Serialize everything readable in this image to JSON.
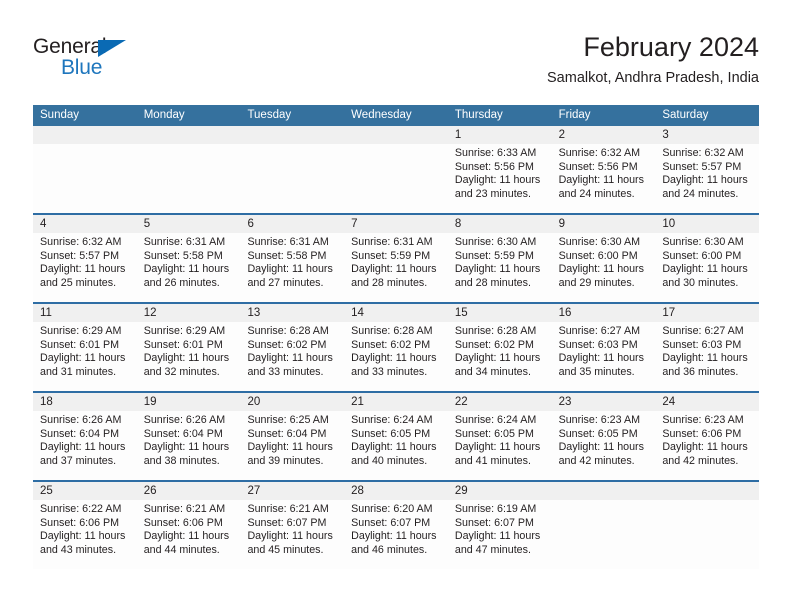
{
  "brand": {
    "name_part1": "General",
    "name_part2": "Blue",
    "triangle_color": "#0a6ab4",
    "blue_text_color": "#1e76bd"
  },
  "header": {
    "title": "February 2024",
    "subtitle": "Samalkot, Andhra Pradesh, India"
  },
  "theme": {
    "header_bg": "#35719e",
    "header_text": "#ffffff",
    "daynum_band_bg": "#f0f0f0",
    "week_separator": "#2e6da4",
    "body_bg": "#fdfdfd",
    "text_color": "#231f20"
  },
  "weekday_headers": [
    "Sunday",
    "Monday",
    "Tuesday",
    "Wednesday",
    "Thursday",
    "Friday",
    "Saturday"
  ],
  "labels": {
    "sunrise_prefix": "Sunrise:",
    "sunset_prefix": "Sunset:",
    "daylight_prefix": "Daylight:"
  },
  "weeks": [
    {
      "days": [
        {
          "num": "",
          "line1": "",
          "line2": "",
          "line3": "",
          "line4": ""
        },
        {
          "num": "",
          "line1": "",
          "line2": "",
          "line3": "",
          "line4": ""
        },
        {
          "num": "",
          "line1": "",
          "line2": "",
          "line3": "",
          "line4": ""
        },
        {
          "num": "",
          "line1": "",
          "line2": "",
          "line3": "",
          "line4": ""
        },
        {
          "num": "1",
          "line1": "Sunrise: 6:33 AM",
          "line2": "Sunset: 5:56 PM",
          "line3": "Daylight: 11 hours",
          "line4": "and 23 minutes."
        },
        {
          "num": "2",
          "line1": "Sunrise: 6:32 AM",
          "line2": "Sunset: 5:56 PM",
          "line3": "Daylight: 11 hours",
          "line4": "and 24 minutes."
        },
        {
          "num": "3",
          "line1": "Sunrise: 6:32 AM",
          "line2": "Sunset: 5:57 PM",
          "line3": "Daylight: 11 hours",
          "line4": "and 24 minutes."
        }
      ]
    },
    {
      "days": [
        {
          "num": "4",
          "line1": "Sunrise: 6:32 AM",
          "line2": "Sunset: 5:57 PM",
          "line3": "Daylight: 11 hours",
          "line4": "and 25 minutes."
        },
        {
          "num": "5",
          "line1": "Sunrise: 6:31 AM",
          "line2": "Sunset: 5:58 PM",
          "line3": "Daylight: 11 hours",
          "line4": "and 26 minutes."
        },
        {
          "num": "6",
          "line1": "Sunrise: 6:31 AM",
          "line2": "Sunset: 5:58 PM",
          "line3": "Daylight: 11 hours",
          "line4": "and 27 minutes."
        },
        {
          "num": "7",
          "line1": "Sunrise: 6:31 AM",
          "line2": "Sunset: 5:59 PM",
          "line3": "Daylight: 11 hours",
          "line4": "and 28 minutes."
        },
        {
          "num": "8",
          "line1": "Sunrise: 6:30 AM",
          "line2": "Sunset: 5:59 PM",
          "line3": "Daylight: 11 hours",
          "line4": "and 28 minutes."
        },
        {
          "num": "9",
          "line1": "Sunrise: 6:30 AM",
          "line2": "Sunset: 6:00 PM",
          "line3": "Daylight: 11 hours",
          "line4": "and 29 minutes."
        },
        {
          "num": "10",
          "line1": "Sunrise: 6:30 AM",
          "line2": "Sunset: 6:00 PM",
          "line3": "Daylight: 11 hours",
          "line4": "and 30 minutes."
        }
      ]
    },
    {
      "days": [
        {
          "num": "11",
          "line1": "Sunrise: 6:29 AM",
          "line2": "Sunset: 6:01 PM",
          "line3": "Daylight: 11 hours",
          "line4": "and 31 minutes."
        },
        {
          "num": "12",
          "line1": "Sunrise: 6:29 AM",
          "line2": "Sunset: 6:01 PM",
          "line3": "Daylight: 11 hours",
          "line4": "and 32 minutes."
        },
        {
          "num": "13",
          "line1": "Sunrise: 6:28 AM",
          "line2": "Sunset: 6:02 PM",
          "line3": "Daylight: 11 hours",
          "line4": "and 33 minutes."
        },
        {
          "num": "14",
          "line1": "Sunrise: 6:28 AM",
          "line2": "Sunset: 6:02 PM",
          "line3": "Daylight: 11 hours",
          "line4": "and 33 minutes."
        },
        {
          "num": "15",
          "line1": "Sunrise: 6:28 AM",
          "line2": "Sunset: 6:02 PM",
          "line3": "Daylight: 11 hours",
          "line4": "and 34 minutes."
        },
        {
          "num": "16",
          "line1": "Sunrise: 6:27 AM",
          "line2": "Sunset: 6:03 PM",
          "line3": "Daylight: 11 hours",
          "line4": "and 35 minutes."
        },
        {
          "num": "17",
          "line1": "Sunrise: 6:27 AM",
          "line2": "Sunset: 6:03 PM",
          "line3": "Daylight: 11 hours",
          "line4": "and 36 minutes."
        }
      ]
    },
    {
      "days": [
        {
          "num": "18",
          "line1": "Sunrise: 6:26 AM",
          "line2": "Sunset: 6:04 PM",
          "line3": "Daylight: 11 hours",
          "line4": "and 37 minutes."
        },
        {
          "num": "19",
          "line1": "Sunrise: 6:26 AM",
          "line2": "Sunset: 6:04 PM",
          "line3": "Daylight: 11 hours",
          "line4": "and 38 minutes."
        },
        {
          "num": "20",
          "line1": "Sunrise: 6:25 AM",
          "line2": "Sunset: 6:04 PM",
          "line3": "Daylight: 11 hours",
          "line4": "and 39 minutes."
        },
        {
          "num": "21",
          "line1": "Sunrise: 6:24 AM",
          "line2": "Sunset: 6:05 PM",
          "line3": "Daylight: 11 hours",
          "line4": "and 40 minutes."
        },
        {
          "num": "22",
          "line1": "Sunrise: 6:24 AM",
          "line2": "Sunset: 6:05 PM",
          "line3": "Daylight: 11 hours",
          "line4": "and 41 minutes."
        },
        {
          "num": "23",
          "line1": "Sunrise: 6:23 AM",
          "line2": "Sunset: 6:05 PM",
          "line3": "Daylight: 11 hours",
          "line4": "and 42 minutes."
        },
        {
          "num": "24",
          "line1": "Sunrise: 6:23 AM",
          "line2": "Sunset: 6:06 PM",
          "line3": "Daylight: 11 hours",
          "line4": "and 42 minutes."
        }
      ]
    },
    {
      "days": [
        {
          "num": "25",
          "line1": "Sunrise: 6:22 AM",
          "line2": "Sunset: 6:06 PM",
          "line3": "Daylight: 11 hours",
          "line4": "and 43 minutes."
        },
        {
          "num": "26",
          "line1": "Sunrise: 6:21 AM",
          "line2": "Sunset: 6:06 PM",
          "line3": "Daylight: 11 hours",
          "line4": "and 44 minutes."
        },
        {
          "num": "27",
          "line1": "Sunrise: 6:21 AM",
          "line2": "Sunset: 6:07 PM",
          "line3": "Daylight: 11 hours",
          "line4": "and 45 minutes."
        },
        {
          "num": "28",
          "line1": "Sunrise: 6:20 AM",
          "line2": "Sunset: 6:07 PM",
          "line3": "Daylight: 11 hours",
          "line4": "and 46 minutes."
        },
        {
          "num": "29",
          "line1": "Sunrise: 6:19 AM",
          "line2": "Sunset: 6:07 PM",
          "line3": "Daylight: 11 hours",
          "line4": "and 47 minutes."
        },
        {
          "num": "",
          "line1": "",
          "line2": "",
          "line3": "",
          "line4": ""
        },
        {
          "num": "",
          "line1": "",
          "line2": "",
          "line3": "",
          "line4": ""
        }
      ]
    }
  ]
}
